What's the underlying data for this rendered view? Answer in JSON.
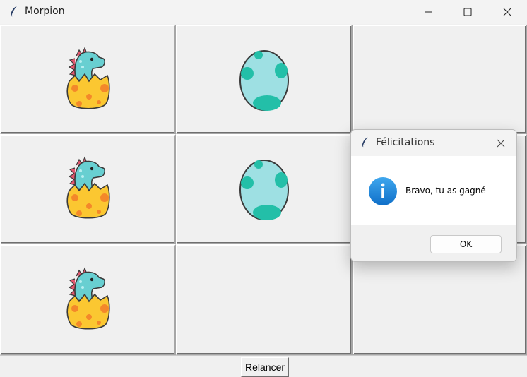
{
  "window": {
    "title": "Morpion",
    "app_icon": "feather-icon",
    "controls": [
      "minimize-icon",
      "maximize-icon",
      "close-icon"
    ]
  },
  "board": {
    "cells": [
      [
        "dino",
        "egg",
        ""
      ],
      [
        "dino",
        "egg",
        ""
      ],
      [
        "dino",
        "",
        ""
      ]
    ],
    "colors": {
      "egg_base": "#9ee0e3",
      "egg_spots": "#23bfa8",
      "shell": "#fbc731",
      "shell_spots": "#f4882a",
      "dino": "#68cfd1",
      "spikes": "#e4566d"
    }
  },
  "footer": {
    "restart_label": "Relancer"
  },
  "dialog": {
    "title": "Félicitations",
    "message": "Bravo, tu as gagné",
    "ok_label": "OK",
    "icon": "info-icon",
    "accent": "#1a7ed6"
  }
}
